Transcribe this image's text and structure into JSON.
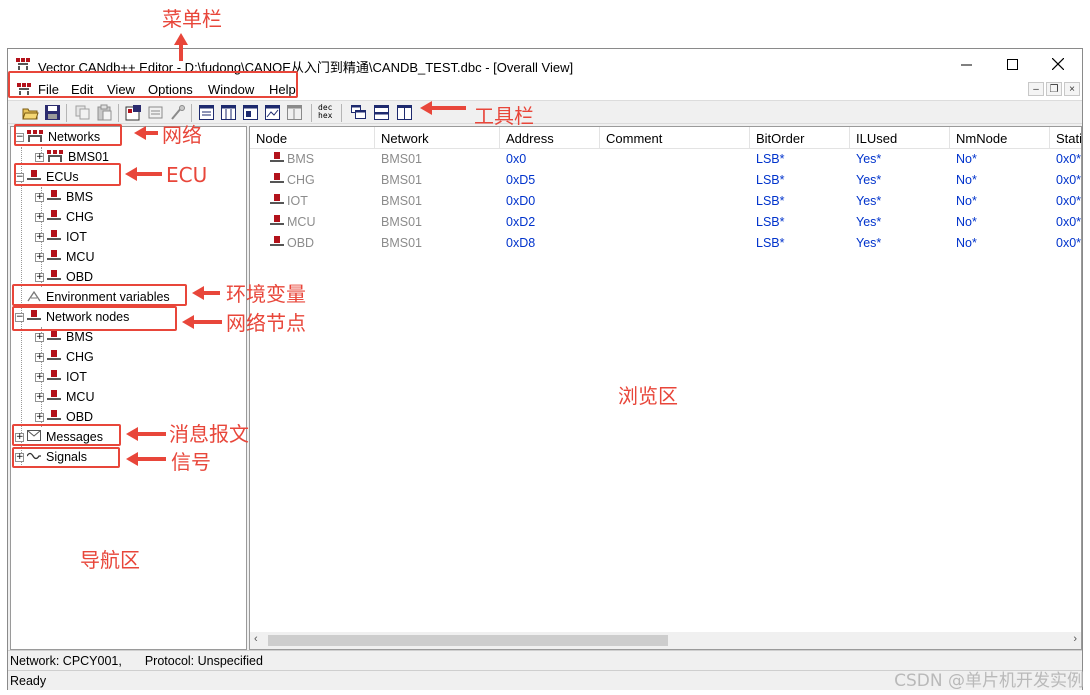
{
  "window": {
    "title": "Vector CANdb++ Editor - D:\\fudong\\CANOE从入门到精通\\CANDB_TEST.dbc - [Overall View]",
    "minimize_icon": "minimize-icon",
    "maximize_icon": "maximize-icon",
    "close_icon": "close-icon"
  },
  "menubar": {
    "items": [
      "File",
      "Edit",
      "View",
      "Options",
      "Window",
      "Help"
    ]
  },
  "toolbar": {
    "icons": [
      "open-folder-icon",
      "save-icon",
      "copy-icon",
      "paste-icon",
      "properties-icon",
      "object-icon",
      "wizard-icon",
      "table-view-icon",
      "grid-view-icon",
      "window-view-icon",
      "chart-view-icon",
      "split-view-icon",
      "dec-hex-icon",
      "cascade-icon",
      "tile-horizontal-icon",
      "tile-vertical-icon"
    ]
  },
  "tree": {
    "networks": {
      "label": "Networks",
      "children": [
        "BMS01"
      ]
    },
    "ecus": {
      "label": "ECUs",
      "children": [
        "BMS",
        "CHG",
        "IOT",
        "MCU",
        "OBD"
      ]
    },
    "env": {
      "label": "Environment variables"
    },
    "nodes": {
      "label": "Network nodes",
      "children": [
        "BMS",
        "CHG",
        "IOT",
        "MCU",
        "OBD"
      ]
    },
    "messages": {
      "label": "Messages"
    },
    "signals": {
      "label": "Signals"
    }
  },
  "table": {
    "columns": [
      "Node",
      "Network",
      "Address",
      "Comment",
      "BitOrder",
      "ILUsed",
      "NmNode",
      "Stati"
    ],
    "rows": [
      [
        "BMS",
        "BMS01",
        "0x0",
        "",
        "LSB*",
        "Yes*",
        "No*",
        "0x0*"
      ],
      [
        "CHG",
        "BMS01",
        "0xD5",
        "",
        "LSB*",
        "Yes*",
        "No*",
        "0x0*"
      ],
      [
        "IOT",
        "BMS01",
        "0xD0",
        "",
        "LSB*",
        "Yes*",
        "No*",
        "0x0*"
      ],
      [
        "MCU",
        "BMS01",
        "0xD2",
        "",
        "LSB*",
        "Yes*",
        "No*",
        "0x0*"
      ],
      [
        "OBD",
        "BMS01",
        "0xD8",
        "",
        "LSB*",
        "Yes*",
        "No*",
        "0x0*"
      ]
    ]
  },
  "status": {
    "line1_network": "Network: CPCY001,",
    "line1_protocol": "Protocol: Unspecified",
    "line2": "Ready"
  },
  "annotations": {
    "menubar": "菜单栏",
    "toolbar": "工具栏",
    "networks": "网络",
    "ecu": "ECU",
    "env": "环境变量",
    "nodes": "网络节点",
    "browse": "浏览区",
    "messages": "消息报文",
    "signals": "信号",
    "nav": "导航区"
  },
  "watermark": "CSDN @单片机开发实例",
  "colors": {
    "annotation": "#e8463a",
    "address_blue": "#0033cc",
    "node_grey": "#8c8c8c",
    "ecu_icon_red": "#b3121b"
  }
}
